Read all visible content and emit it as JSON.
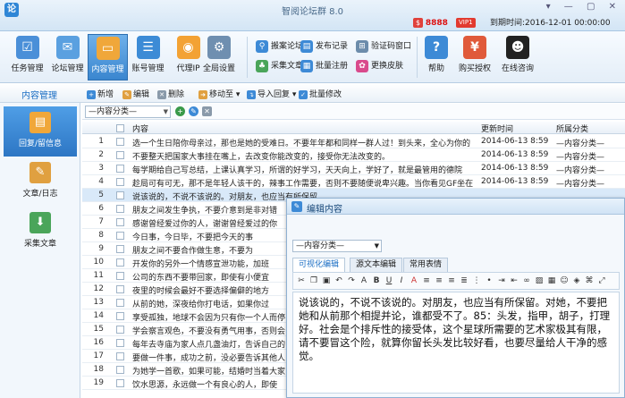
{
  "window": {
    "title": "智阅论坛群 8.0",
    "points": "8888",
    "vip": "VIP1",
    "expire_text": "到期时间:2016-12-01 00:00:00"
  },
  "toolbar": {
    "main_buttons": [
      {
        "label": "任务管理",
        "icon": "clipboard-icon",
        "color": "#4a8fd8"
      },
      {
        "label": "论坛管理",
        "icon": "forum-icon",
        "color": "#5aa0e0"
      },
      {
        "label": "内容管理",
        "icon": "folder-icon",
        "color": "#f0a73a"
      },
      {
        "label": "账号管理",
        "icon": "accounts-icon",
        "color": "#3c8bd6"
      },
      {
        "label": "代理IP",
        "icon": "location-pin-icon",
        "color": "#f3a234"
      },
      {
        "label": "全局设置",
        "icon": "gear-icon",
        "color": "#6f8fb0"
      }
    ],
    "small_buttons": [
      {
        "label": "搬案论坛",
        "icon": "search-icon",
        "color": "#3d8ad6"
      },
      {
        "label": "采集文章",
        "icon": "collect-icon",
        "color": "#4aa55a"
      },
      {
        "label": "发布记录",
        "icon": "record-icon",
        "color": "#3d8ad6"
      },
      {
        "label": "批量注册",
        "icon": "register-icon",
        "color": "#3d8ad6"
      },
      {
        "label": "验证码窗口",
        "icon": "captcha-icon",
        "color": "#6c8cab"
      },
      {
        "label": "更换皮肤",
        "icon": "skin-icon",
        "color": "#d94a8c"
      }
    ],
    "right_buttons": [
      {
        "label": "帮助",
        "icon": "help-icon",
        "color": "#3d8ad6"
      },
      {
        "label": "购买授权",
        "icon": "buy-icon",
        "color": "#e05a3a"
      },
      {
        "label": "在线咨询",
        "icon": "qq-icon",
        "color": "#222222"
      }
    ]
  },
  "ribbon": {
    "module_title": "内容管理",
    "buttons": [
      "新增",
      "编辑",
      "删除",
      "移动至",
      "导入回复",
      "批量修改"
    ]
  },
  "sidebar": {
    "items": [
      {
        "label": "回复/留信息",
        "icon": "reply-note-icon",
        "color": "#f0a73a"
      },
      {
        "label": "文章/日志",
        "icon": "article-icon",
        "color": "#e0a040"
      },
      {
        "label": "采集文章",
        "icon": "download-arrow-icon",
        "color": "#4aa55a"
      }
    ]
  },
  "filter": {
    "category": "—内容分类—"
  },
  "grid": {
    "columns": [
      "内容",
      "更新时间",
      "所属分类"
    ],
    "rows": [
      {
        "n": "1",
        "content": "选一个生日陪你母亲过，那也是她的受难日。不要年年都和同样一群人过！到头来，全心为你的",
        "time": "2014-06-13 8:59",
        "cat": "—内容分类—"
      },
      {
        "n": "2",
        "content": "不要整天把国家大事挂在嘴上，去改变你能改变的，接受你无法改变的。",
        "time": "2014-06-13 8:59",
        "cat": "—内容分类—"
      },
      {
        "n": "3",
        "content": "每学期给自己写总结，上课认真学习，所谓的好学习，天天向上，学好了，就是最管用的德院",
        "time": "2014-06-13 8:59",
        "cat": "—内容分类—"
      },
      {
        "n": "4",
        "content": "趁局可有可无，那不是年轻人该干的，辣事工作需要，否则不要随便说卑兴趣。当你看见GF坐在",
        "time": "2014-06-13 8:59",
        "cat": "—内容分类—"
      },
      {
        "n": "5",
        "content": "说该说的，不说不该说的。对朋友，也应当有所保留",
        "time": "",
        "cat": ""
      },
      {
        "n": "6",
        "content": "朋友之间发生争执，不要介意到是非对错",
        "time": "",
        "cat": ""
      },
      {
        "n": "7",
        "content": "感谢曾经爱过你的人，谢谢曾经爱过的你",
        "time": "",
        "cat": ""
      },
      {
        "n": "8",
        "content": "今日事，今日毕，不要把今天的事",
        "time": "",
        "cat": ""
      },
      {
        "n": "9",
        "content": "朋友之间不要合作做生意，不要为",
        "time": "",
        "cat": ""
      },
      {
        "n": "10",
        "content": "开发你的另外一个情感宣泄功能，加班",
        "time": "",
        "cat": ""
      },
      {
        "n": "11",
        "content": "公司的东西不要带回家，即使有小便宜",
        "time": "",
        "cat": ""
      },
      {
        "n": "12",
        "content": "夜里的时候会最好不要选择偏僻的地方",
        "time": "",
        "cat": ""
      },
      {
        "n": "13",
        "content": "从前的她，深夜给你打电话，如果你过",
        "time": "",
        "cat": ""
      },
      {
        "n": "14",
        "content": "享受孤独，地球不会因为只有你一个人而停",
        "time": "",
        "cat": ""
      },
      {
        "n": "15",
        "content": "学会察言观色，不要没有勇气用事，否则会",
        "time": "",
        "cat": ""
      },
      {
        "n": "16",
        "content": "每年去寺庙为家人点几盏油灯，告诉自己的",
        "time": "",
        "cat": ""
      },
      {
        "n": "17",
        "content": "要做一件事，成功之前，没必要告诉其他人",
        "time": "",
        "cat": ""
      },
      {
        "n": "18",
        "content": "为她学一首歌，如果可能，结婚时当着大家",
        "time": "",
        "cat": ""
      },
      {
        "n": "19",
        "content": "饮水思源，永远做一个有良心的人，即使",
        "time": "",
        "cat": ""
      }
    ]
  },
  "editor": {
    "title": "编辑内容",
    "category": "—内容分类—",
    "tabs": [
      "可视化编辑",
      "源文本编辑",
      "常用表情"
    ],
    "body": "说该说的，不说不该说的。对朋友，也应当有所保留。对她，不要把她和从前那个相提并论，谁都受不了。85：头发，指甲，胡子，打理好。社会是个排斥性的接受体，这个星球所需要的艺术家极其有限，请不要冒这个险，就算你留长头发比较好看，也要尽量给人干净的感觉。"
  }
}
